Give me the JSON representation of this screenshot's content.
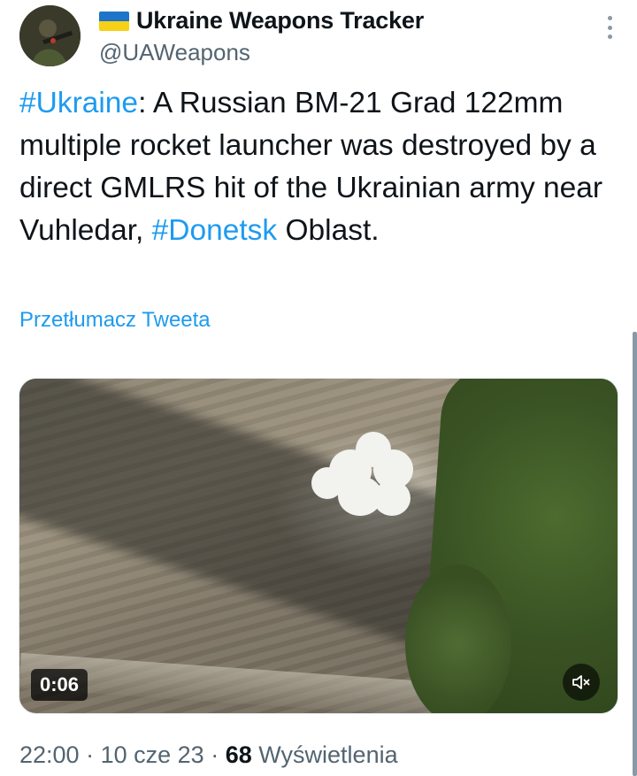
{
  "author": {
    "display_name": "Ukraine Weapons Tracker",
    "handle": "@UAWeapons",
    "flag_icon": "ukraine-flag-icon"
  },
  "tweet": {
    "segments": [
      {
        "text": "#Ukraine",
        "hashtag": true
      },
      {
        "text": ": A Russian BM-21 Grad 122mm multiple rocket launcher was destroyed by a direct GMLRS hit of the Ukrainian army near Vuhledar, ",
        "hashtag": false
      },
      {
        "text": "#Donetsk",
        "hashtag": true
      },
      {
        "text": " Oblast.",
        "hashtag": false
      }
    ],
    "translate_label": "Przetłumacz Tweeta"
  },
  "media": {
    "duration": "0:06",
    "mute_icon": "speaker-muted-icon"
  },
  "meta": {
    "time": "22:00",
    "date": "10 cze 23",
    "separator": "·",
    "views_count": "68",
    "views_label": "Wyświetlenia"
  },
  "colors": {
    "hashtag": "#1d9bf0",
    "secondary_text": "#536471"
  }
}
